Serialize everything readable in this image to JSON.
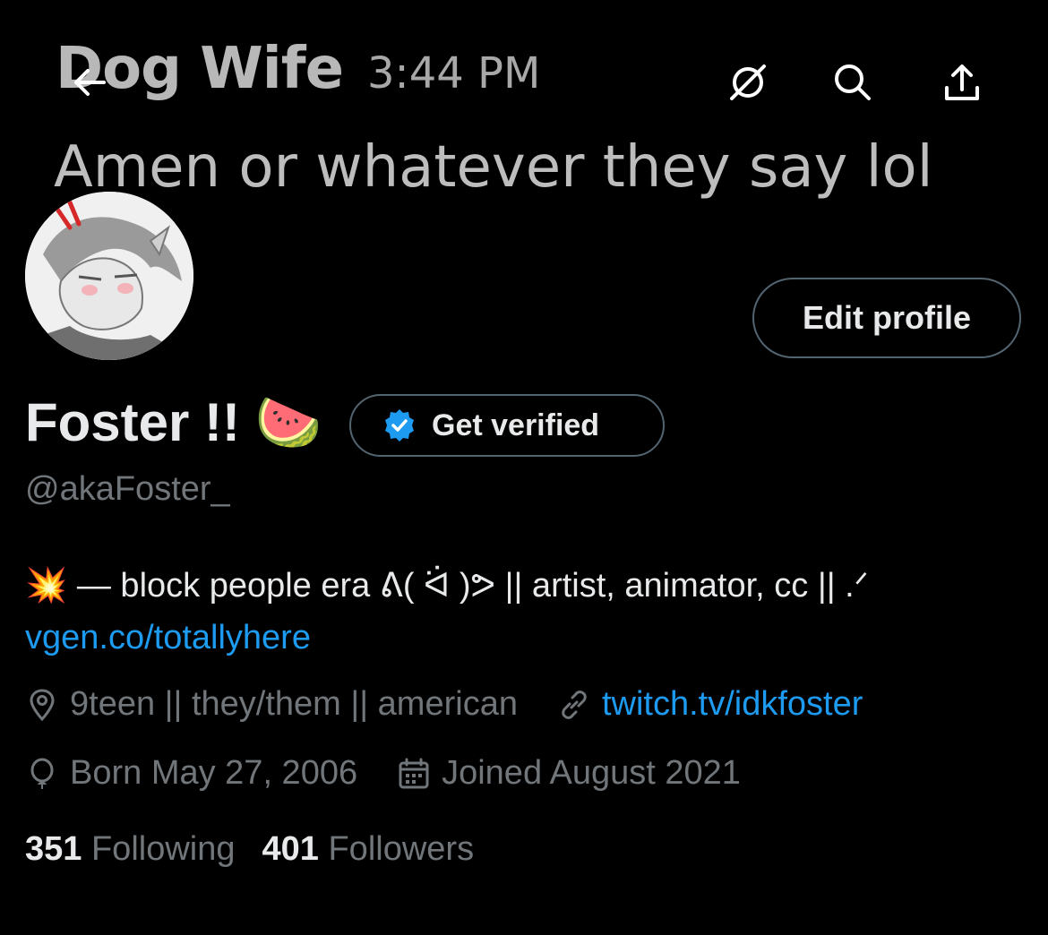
{
  "header": {
    "banner_name": "Dog Wife",
    "banner_time": "3:44 PM",
    "banner_text": "Amen or whatever they say lol",
    "icons": [
      "back-arrow-icon",
      "no-signal-icon",
      "search-icon",
      "share-icon"
    ]
  },
  "profile": {
    "display_name": "Foster !! 🍉",
    "handle": "@akaFoster_",
    "edit_profile_label": "Edit profile",
    "get_verified_label": "Get verified",
    "bio_text": "💥 — block people era ᕕ( ᐛ )ᕗ || artist, animator, cc || .ᐟ",
    "bio_link": "vgen.co/totallyhere",
    "location": "9teen || they/them || american",
    "website": "twitch.tv/idkfoster",
    "birthday": "Born May 27, 2006",
    "joined": "Joined August 2021",
    "following_count": "351",
    "following_label": "Following",
    "followers_count": "401",
    "followers_label": "Followers"
  },
  "colors": {
    "background": "#000000",
    "primary_text": "#e7e9ea",
    "secondary_text": "#71767b",
    "link": "#1d9bf0",
    "border": "#536471"
  }
}
